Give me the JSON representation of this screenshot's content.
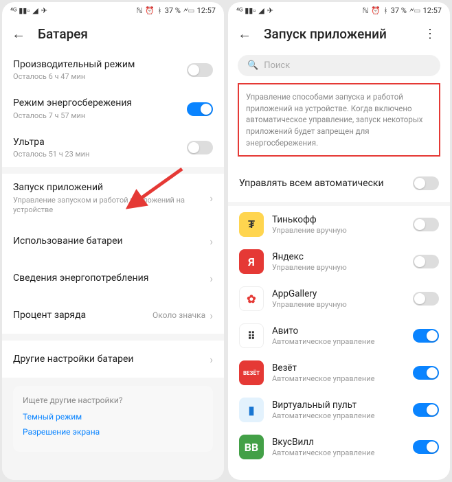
{
  "status": {
    "battery": "37 %",
    "time": "12:57"
  },
  "left": {
    "title": "Батарея",
    "perf": {
      "title": "Производительный режим",
      "sub": "Осталось 6 ч 47 мин"
    },
    "save": {
      "title": "Режим энергосбережения",
      "sub": "Осталось 7 ч 57 мин"
    },
    "ultra": {
      "title": "Ультра",
      "sub": "Осталось 51 ч 23 мин"
    },
    "launch": {
      "title": "Запуск приложений",
      "sub": "Управление запуском и работой приложений на устройстве"
    },
    "usage": {
      "title": "Использование батареи"
    },
    "details": {
      "title": "Сведения энергопотребления"
    },
    "percent": {
      "title": "Процент заряда",
      "right": "Около значка"
    },
    "other": {
      "title": "Другие настройки батареи"
    },
    "info": {
      "q": "Ищете другие настройки?",
      "l1": "Темный режим",
      "l2": "Разрешение экрана"
    }
  },
  "right": {
    "title": "Запуск приложений",
    "search_placeholder": "Поиск",
    "desc": "Управление способами запуска и работой приложений на устройстве. Когда включено автоматическое управление, запуск некоторых приложений будет запрещен для энергосбережения.",
    "auto_all": "Управлять всем автоматически",
    "sub_manual": "Управление вручную",
    "sub_auto": "Автоматическое управление",
    "apps": [
      {
        "name": "Тинькофф",
        "manual": true,
        "on": false,
        "bg": "#ffd54f",
        "fg": "#333",
        "glyph": "₮"
      },
      {
        "name": "Яндекс",
        "manual": true,
        "on": false,
        "bg": "#e53935",
        "fg": "#fff",
        "glyph": "Я"
      },
      {
        "name": "AppGallery",
        "manual": true,
        "on": false,
        "bg": "#fff",
        "fg": "#e53935",
        "glyph": "✿"
      },
      {
        "name": "Авито",
        "manual": false,
        "on": true,
        "bg": "#fff",
        "fg": "#333",
        "glyph": "⠿"
      },
      {
        "name": "Везёт",
        "manual": false,
        "on": true,
        "bg": "#e53935",
        "fg": "#fff",
        "glyph": "ВЕЗЁТ"
      },
      {
        "name": "Виртуальный пульт",
        "manual": false,
        "on": true,
        "bg": "#e3f2fd",
        "fg": "#1976d2",
        "glyph": "▮"
      },
      {
        "name": "ВкусВилл",
        "manual": false,
        "on": true,
        "bg": "#43a047",
        "fg": "#fff",
        "glyph": "ВВ"
      }
    ]
  }
}
